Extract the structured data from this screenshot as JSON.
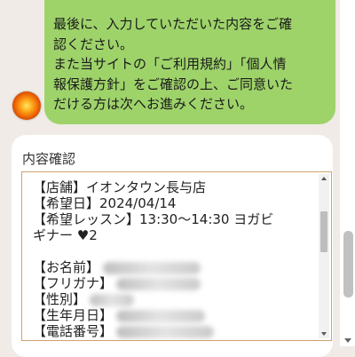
{
  "chat": {
    "message_lines": [
      "最後に、入力していただいた内容をご確",
      "認ください。",
      "また当サイトの「ご利用規約」「個人情",
      "報保護方針」をご確認の上、ご同意いた",
      "だける方は次へお進みください。"
    ]
  },
  "confirm": {
    "title": "内容確認",
    "lines": [
      "【店舗】イオンタウン長与店",
      "【希望日】2024/04/14",
      "【希望レッスン】13:30～14:30 ヨガビ",
      "ギナー ♥2",
      "",
      "【お名前】",
      "【フリガナ】",
      "【性別】",
      "【生年月日】",
      "【電話番号】"
    ]
  },
  "icons": {
    "avatar": "orange-sun-avatar-icon"
  },
  "colors": {
    "bubble": "#9ed36a",
    "background": "#f0ebe6",
    "textbox_border": "#cfa36e"
  }
}
